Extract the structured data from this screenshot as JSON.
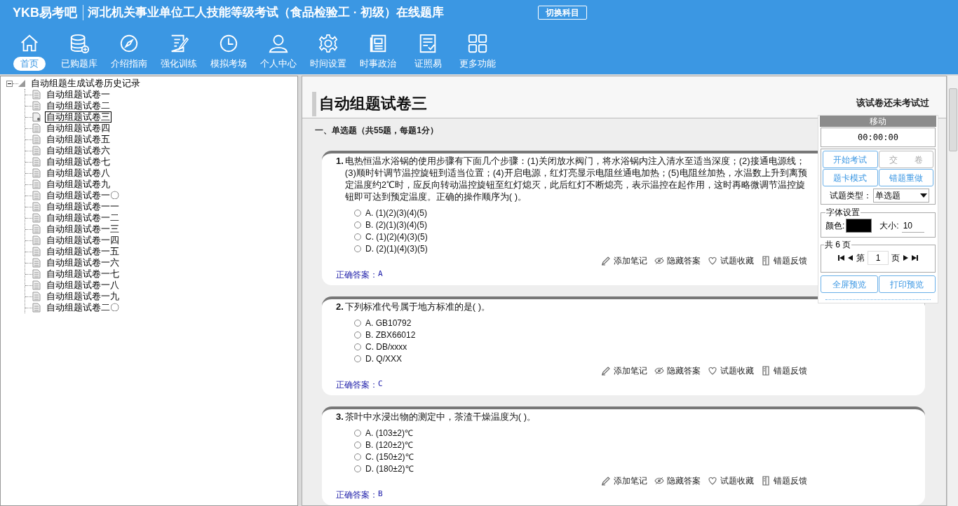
{
  "header": {
    "logo": "YKB易考吧",
    "title": "河北机关事业单位工人技能等级考试（食品检验工 · 初级）在线题库",
    "switch_button": "切换科目"
  },
  "nav": [
    {
      "label": "首页",
      "selected": true
    },
    {
      "label": "已购题库",
      "selected": false
    },
    {
      "label": "介绍指南",
      "selected": false
    },
    {
      "label": "强化训练",
      "selected": false
    },
    {
      "label": "模拟考场",
      "selected": false
    },
    {
      "label": "个人中心",
      "selected": false
    },
    {
      "label": "时间设置",
      "selected": false
    },
    {
      "label": "时事政治",
      "selected": false
    },
    {
      "label": "证照易",
      "selected": false
    },
    {
      "label": "更多功能",
      "selected": false
    }
  ],
  "tree": {
    "label": "自动组题生成试卷历史记录",
    "expanded": true,
    "children": [
      {
        "label": "自动组题试卷一",
        "selected": false
      },
      {
        "label": "自动组题试卷二",
        "selected": false
      },
      {
        "label": "自动组题试卷三",
        "selected": true
      },
      {
        "label": "自动组题试卷四",
        "selected": false
      },
      {
        "label": "自动组题试卷五",
        "selected": false
      },
      {
        "label": "自动组题试卷六",
        "selected": false
      },
      {
        "label": "自动组题试卷七",
        "selected": false
      },
      {
        "label": "自动组题试卷八",
        "selected": false
      },
      {
        "label": "自动组题试卷九",
        "selected": false
      },
      {
        "label": "自动组题试卷一〇",
        "selected": false
      },
      {
        "label": "自动组题试卷一一",
        "selected": false
      },
      {
        "label": "自动组题试卷一二",
        "selected": false
      },
      {
        "label": "自动组题试卷一三",
        "selected": false
      },
      {
        "label": "自动组题试卷一四",
        "selected": false
      },
      {
        "label": "自动组题试卷一五",
        "selected": false
      },
      {
        "label": "自动组题试卷一六",
        "selected": false
      },
      {
        "label": "自动组题试卷一七",
        "selected": false
      },
      {
        "label": "自动组题试卷一八",
        "selected": false
      },
      {
        "label": "自动组题试卷一九",
        "selected": false
      },
      {
        "label": "自动组题试卷二〇",
        "selected": false
      }
    ]
  },
  "paper": {
    "title": "自动组题试卷三",
    "status": "该试卷还未考试过",
    "section": "一、单选题（共55题，每题1分）",
    "questions": [
      {
        "number": "1.",
        "text": "电热恒温水浴锅的使用步骤有下面几个步骤：(1)关闭放水阀门，将水浴锅内注入清水至适当深度；(2)接通电源线；(3)顺时针调节温控旋钮到适当位置；(4)开启电源，红灯亮显示电阻丝通电加热；(5)电阻丝加热，水温数上升到离预定温度约2℃时，应反向转动温控旋钮至红灯熄灭，此后红灯不断熄亮，表示温控在起作用，这时再略微调节温控旋钮即可达到预定温度。正确的操作顺序为( )。",
        "options": [
          {
            "label": "A. (1)(2)(3)(4)(5)",
            "selected": false
          },
          {
            "label": "B. (2)(1)(3)(4)(5)",
            "selected": false
          },
          {
            "label": "C. (1)(2)(4)(3)(5)",
            "selected": false
          },
          {
            "label": "D. (2)(1)(4)(3)(5)",
            "selected": false
          }
        ],
        "actions": [
          "添加笔记",
          "隐藏答案",
          "试题收藏",
          "错题反馈"
        ],
        "answer_label": "正确答案：",
        "answer": "A"
      },
      {
        "number": "2.",
        "text": "下列标准代号属于地方标准的是( )。",
        "options": [
          {
            "label": "A. GB10792",
            "selected": false
          },
          {
            "label": "B. ZBX66012",
            "selected": false
          },
          {
            "label": "C. DB/xxxx",
            "selected": false
          },
          {
            "label": "D. Q/XXX",
            "selected": false
          }
        ],
        "actions": [
          "添加笔记",
          "隐藏答案",
          "试题收藏",
          "错题反馈"
        ],
        "answer_label": "正确答案：",
        "answer": "C"
      },
      {
        "number": "3.",
        "text": "茶叶中水浸出物的测定中，茶渣干燥温度为( )。",
        "options": [
          {
            "label": "A. (103±2)℃",
            "selected": false
          },
          {
            "label": "B. (120±2)℃",
            "selected": false
          },
          {
            "label": "C. (150±2)℃",
            "selected": false
          },
          {
            "label": "D. (180±2)℃",
            "selected": false
          }
        ],
        "actions": [
          "添加笔记",
          "隐藏答案",
          "试题收藏",
          "错题反馈"
        ],
        "answer_label": "正确答案：",
        "answer": "B"
      }
    ]
  },
  "panel": {
    "title": "移动",
    "timer": "00:00:00",
    "buttons": [
      {
        "label": "开始考试",
        "disabled": false
      },
      {
        "label": "交　　卷",
        "disabled": true
      },
      {
        "label": "题卡模式",
        "disabled": false
      },
      {
        "label": "错题重做",
        "disabled": false
      }
    ],
    "type_label": "试题类型：",
    "type_value": "单选题",
    "font_legend": "字体设置",
    "color_label": "颜色:",
    "size_label": "大小:",
    "size_value": "10",
    "pages_legend": "共 6 页",
    "page_prefix": "第",
    "page_value": "1",
    "page_suffix": "页",
    "bottom_buttons": [
      "全屏预览",
      "打印预览"
    ]
  }
}
